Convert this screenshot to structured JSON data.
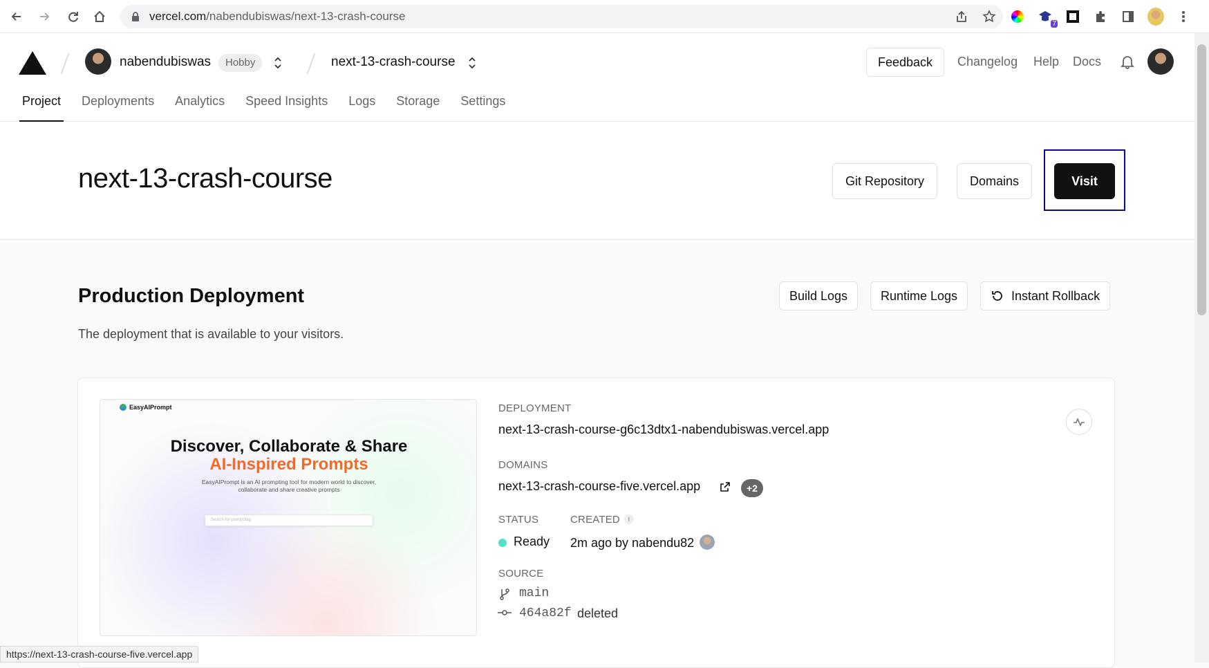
{
  "browser": {
    "url_domain": "vercel.com",
    "url_path": "/nabendubiswas/next-13-crash-course",
    "extension_badge": "7"
  },
  "header": {
    "team_name": "nabendubiswas",
    "plan_badge": "Hobby",
    "project_name": "next-13-crash-course",
    "feedback_label": "Feedback",
    "changelog_label": "Changelog",
    "help_label": "Help",
    "docs_label": "Docs"
  },
  "tabs": [
    {
      "label": "Project",
      "active": true
    },
    {
      "label": "Deployments"
    },
    {
      "label": "Analytics"
    },
    {
      "label": "Speed Insights"
    },
    {
      "label": "Logs"
    },
    {
      "label": "Storage"
    },
    {
      "label": "Settings"
    }
  ],
  "project": {
    "title": "next-13-crash-course",
    "git_repository_label": "Git Repository",
    "domains_label": "Domains",
    "visit_label": "Visit"
  },
  "production": {
    "title": "Production Deployment",
    "description": "The deployment that is available to your visitors.",
    "build_logs_label": "Build Logs",
    "runtime_logs_label": "Runtime Logs",
    "instant_rollback_label": "Instant Rollback"
  },
  "preview": {
    "logo_text": "EasyAIPrompt",
    "heading_line1": "Discover, Collaborate & Share",
    "heading_line2": "AI-Inspired Prompts",
    "paragraph": "EasyAIPrompt is an AI prompting tool for modern world to discover, collaborate and share creative prompts",
    "search_placeholder": "Search for prompt/tag"
  },
  "deployment": {
    "deployment_label": "DEPLOYMENT",
    "deployment_url": "next-13-crash-course-g6c13dtx1-nabendubiswas.vercel.app",
    "domains_label": "DOMAINS",
    "domain_url": "next-13-crash-course-five.vercel.app",
    "extra_domains": "+2",
    "status_label": "STATUS",
    "status_value": "Ready",
    "status_color": "#50e3c2",
    "created_label": "CREATED",
    "created_value": "2m ago by nabendu82",
    "source_label": "SOURCE",
    "branch": "main",
    "commit_hash": "464a82f",
    "commit_message": "deleted"
  },
  "status_bar": {
    "hover_url": "https://next-13-crash-course-five.vercel.app"
  }
}
